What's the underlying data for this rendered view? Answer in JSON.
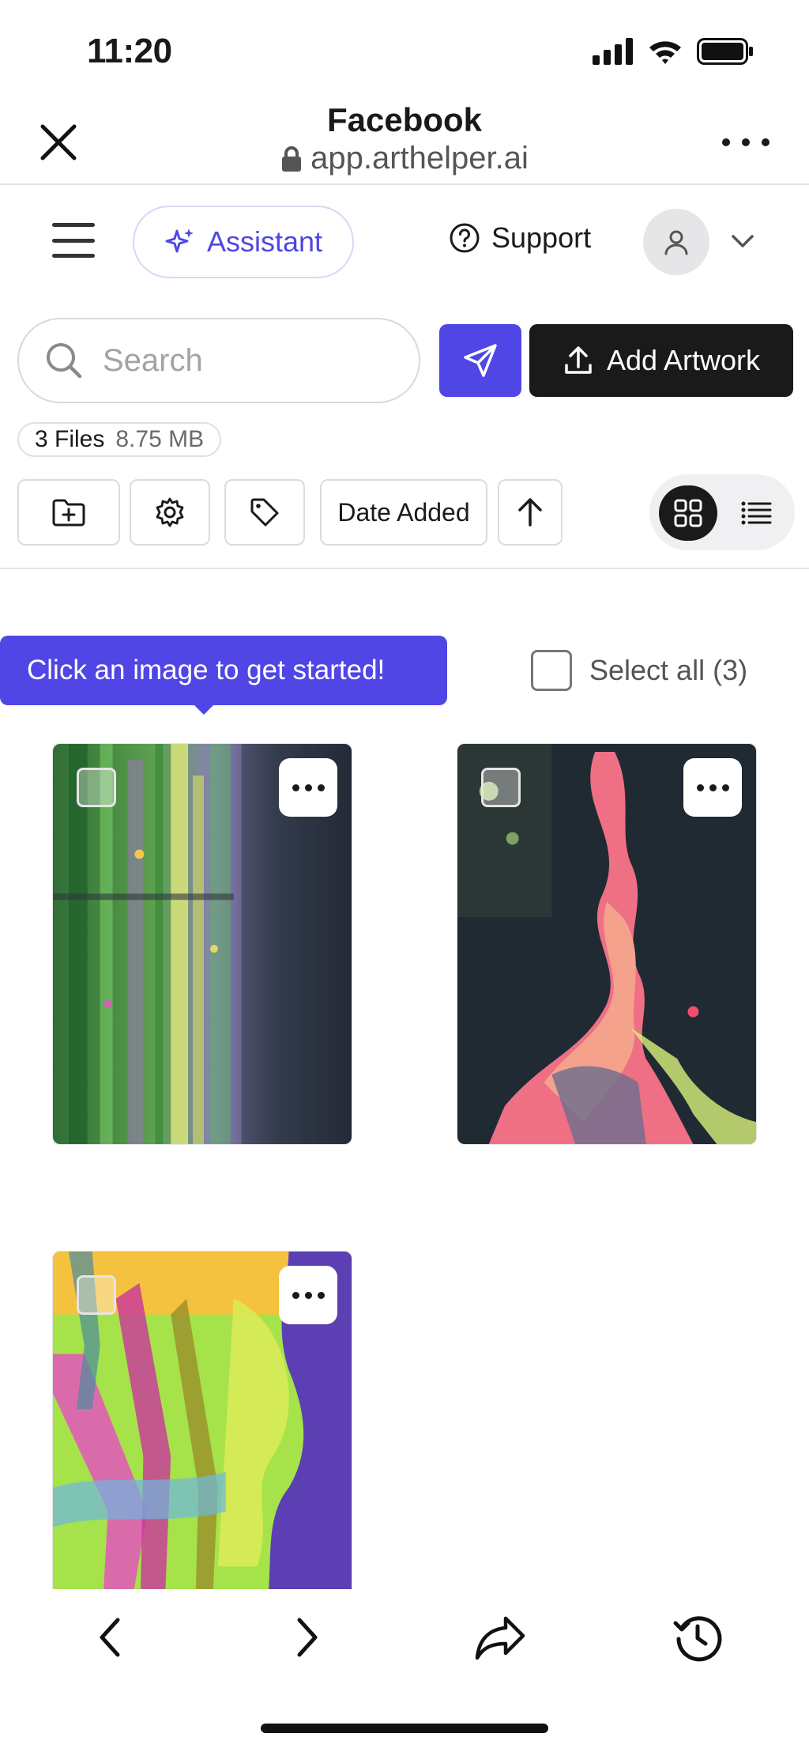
{
  "status_bar": {
    "time": "11:20"
  },
  "browser": {
    "title": "Facebook",
    "url": "app.arthelper.ai"
  },
  "header": {
    "assistant_label": "Assistant",
    "support_label": "Support"
  },
  "search": {
    "placeholder": "Search",
    "add_label": "Add Artwork"
  },
  "files": {
    "count_label": "3 Files",
    "size_label": "8.75 MB"
  },
  "toolbar": {
    "sort_label": "Date Added"
  },
  "tooltip": {
    "text": "Click an image to get started!"
  },
  "select_all": {
    "label": "Select all (3)"
  },
  "icons": {
    "close": "close-icon",
    "lock": "lock-icon",
    "more": "more-icon",
    "menu": "menu-icon",
    "sparkle": "sparkle-icon",
    "help": "help-circle-icon",
    "user": "user-icon",
    "chevron": "chevron-down-icon",
    "search": "search-icon",
    "send": "send-icon",
    "upload": "upload-icon",
    "folder_add": "folder-plus-icon",
    "settings": "gear-icon",
    "tag": "tag-icon",
    "sort": "arrow-up-icon",
    "grid": "grid-icon",
    "list": "list-icon",
    "back": "chevron-left-icon",
    "forward": "chevron-right-icon",
    "share": "share-icon",
    "history": "history-icon"
  },
  "colors": {
    "accent": "#4f46e5",
    "dark": "#1a1a1a",
    "border": "#dcdcdc"
  },
  "artworks": [
    {
      "label": "Green and purple abstract painting"
    },
    {
      "label": "Pink abstract figure on dark background"
    },
    {
      "label": "Colorful trees with face silhouette"
    }
  ]
}
